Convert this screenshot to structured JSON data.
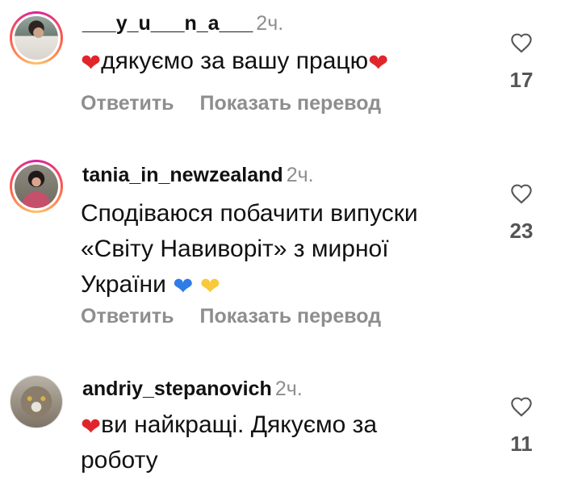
{
  "comments": [
    {
      "username": "___y_u___n_a___",
      "time": "2ч.",
      "text_parts": [
        "дякуємо за вашу працю"
      ],
      "text_line_2": "",
      "likes": "17",
      "reply_label": "Ответить",
      "translate_label": "Показать перевод"
    },
    {
      "username": "tania_in_newzealand",
      "time": "2ч.",
      "text_line_1": "Сподіваюся побачити випуски",
      "text_line_2": "«Світу Навиворіт» з мирної",
      "text_line_3": "України",
      "likes": "23",
      "reply_label": "Ответить",
      "translate_label": "Показать перевод"
    },
    {
      "username": "andriy_stepanovich",
      "time": "2ч.",
      "text_line_1": "ви найкращі. Дякуємо за",
      "text_line_2": "роботу",
      "likes": "11"
    }
  ],
  "colors": {
    "red_heart": "#e0262b",
    "blue_heart": "#2f7ce6",
    "yellow_heart": "#f8c93a",
    "muted_text": "#8e8e8e"
  },
  "icons": [
    "heart-outline-icon",
    "red-heart-emoji",
    "blue-heart-emoji",
    "yellow-heart-emoji"
  ]
}
